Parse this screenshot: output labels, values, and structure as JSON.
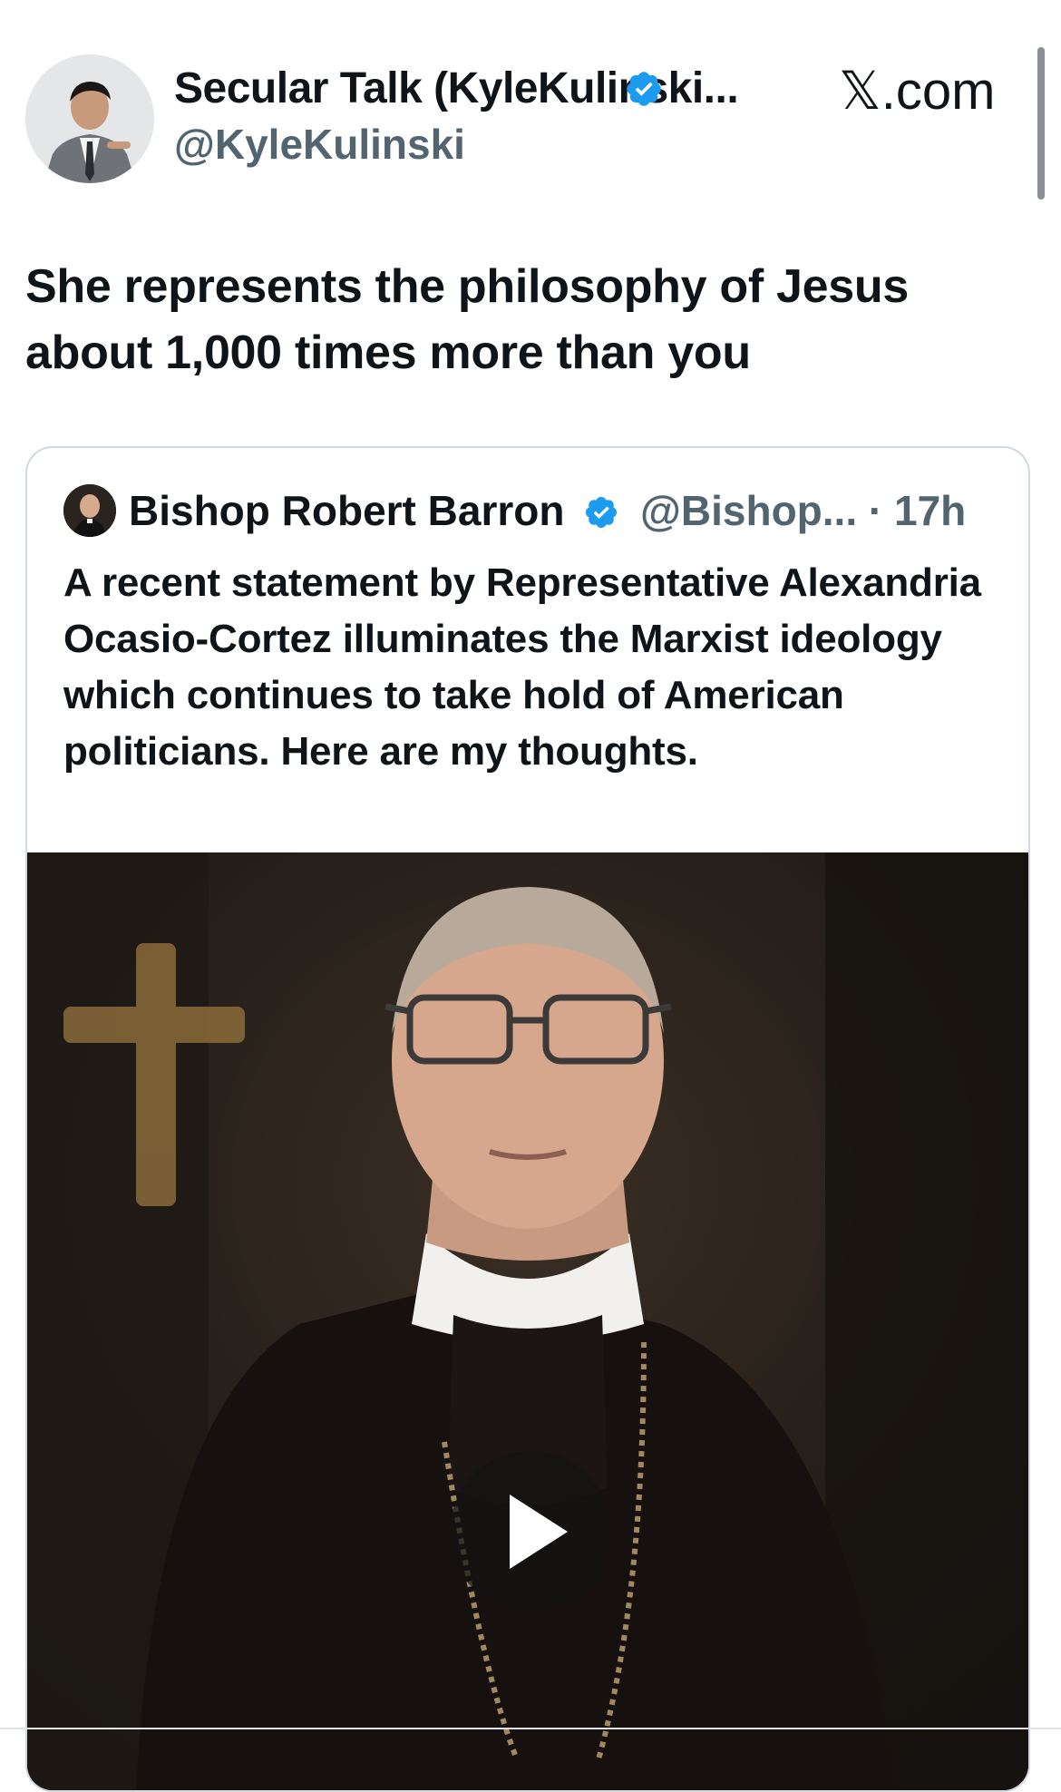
{
  "post": {
    "display_name": "Secular Talk (KyleKulinski...",
    "handle": "@KyleKulinski",
    "site": "𝕏.com",
    "text": "She represents the philosophy of Jesus about 1,000 times more than you"
  },
  "quoted_post": {
    "display_name": "Bishop Robert Barron",
    "handle": "@Bishop...",
    "separator": " · ",
    "time": "17h",
    "text": "A recent statement by Representative Alexandria Ocasio-Cortez illuminates the Marxist ideology which continues to take hold of American politicians. Here are my thoughts."
  },
  "colors": {
    "verified": "#1d9bf0",
    "text": "#0f1419",
    "secondary": "#536471",
    "border": "#cfd9de"
  },
  "icons": {
    "verified": "verified-badge-icon",
    "play": "play-icon"
  }
}
